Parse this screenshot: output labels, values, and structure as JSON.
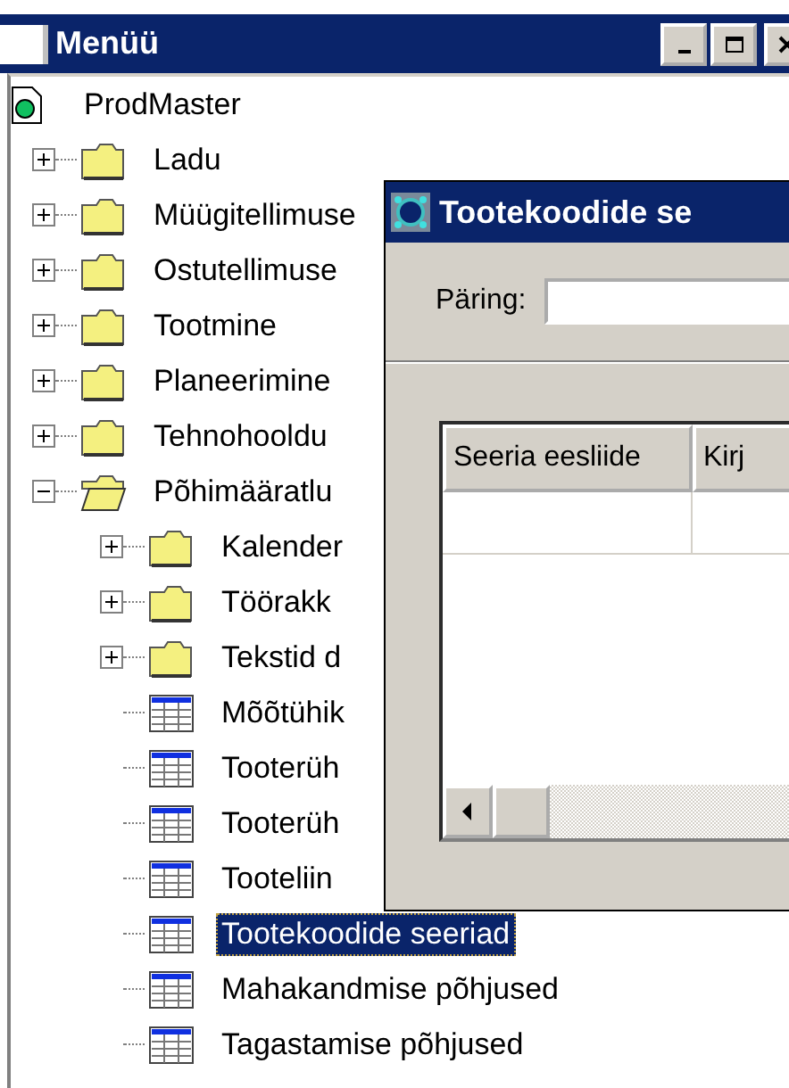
{
  "window": {
    "title": "Menüü"
  },
  "tree": {
    "root": "ProdMaster",
    "children": [
      {
        "label": "Ladu",
        "kind": "folder",
        "expanded": false,
        "selected": false
      },
      {
        "label": "Müügitellimuse",
        "kind": "folder",
        "expanded": false,
        "selected": false
      },
      {
        "label": "Ostutellimuse",
        "kind": "folder",
        "expanded": false,
        "selected": false
      },
      {
        "label": "Tootmine",
        "kind": "folder",
        "expanded": false,
        "selected": false
      },
      {
        "label": "Planeerimine",
        "kind": "folder",
        "expanded": false,
        "selected": false
      },
      {
        "label": "Tehnohooldu",
        "kind": "folder",
        "expanded": false,
        "selected": false
      },
      {
        "label": "Põhimääratlu",
        "kind": "folder",
        "expanded": true,
        "selected": false,
        "children": [
          {
            "label": "Kalender",
            "kind": "folder",
            "expanded": false,
            "selected": false
          },
          {
            "label": "Töörakk",
            "kind": "folder",
            "expanded": false,
            "selected": false
          },
          {
            "label": "Tekstid d",
            "kind": "folder",
            "expanded": false,
            "selected": false
          },
          {
            "label": "Mõõtühik",
            "kind": "table",
            "selected": false
          },
          {
            "label": "Tooterüh",
            "kind": "table",
            "selected": false
          },
          {
            "label": "Tooterüh",
            "kind": "table",
            "selected": false
          },
          {
            "label": "Tooteliin",
            "kind": "table",
            "selected": false
          },
          {
            "label": "Tootekoodide seeriad",
            "kind": "table",
            "selected": true
          },
          {
            "label": "Mahakandmise põhjused",
            "kind": "table",
            "selected": false
          },
          {
            "label": "Tagastamise põhjused",
            "kind": "table",
            "selected": false
          }
        ]
      }
    ]
  },
  "dialog": {
    "title": "Tootekoodide se",
    "query_label": "Päring:",
    "table": {
      "columns": [
        "Seeria eesliide",
        "Kirj"
      ]
    }
  }
}
